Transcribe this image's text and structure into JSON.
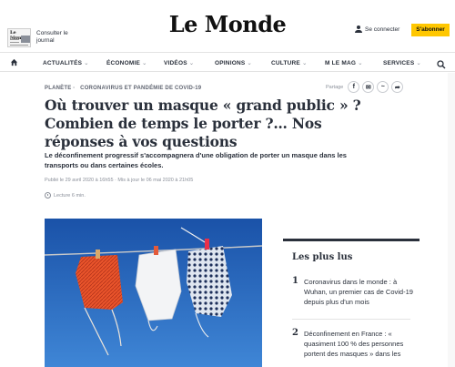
{
  "header": {
    "newspaper_thumb_title": "Le Monde",
    "consult_label": "Consulter le journal",
    "logo": "Le Monde",
    "login_label": "Se connecter",
    "subscribe_label": "S'abonner"
  },
  "nav": {
    "items": [
      "ACTUALITÉS",
      "ÉCONOMIE",
      "VIDÉOS",
      "OPINIONS",
      "CULTURE",
      "M LE MAG",
      "SERVICES"
    ],
    "chevron": "⌄"
  },
  "article": {
    "breadcrumb": [
      "PLANÈTE",
      "CORONAVIRUS ET PANDÉMIE DE COVID-19"
    ],
    "share_label": "Partage",
    "share_buttons": [
      "f",
      "✉",
      "~",
      "➦"
    ],
    "title": "Où trouver un masque « grand public » ? Combien de temps le porter ?… Nos réponses à vos questions",
    "description": "Le déconfinement progressif s'accompagnera d'une obligation de porter un masque dans les transports ou dans certaines écoles.",
    "meta": "Publié le 29 avril 2020 à 16h55 · Mis à jour le 06 mai 2020 à 21h05",
    "reading_time": "Lecture 6 min."
  },
  "sidebar": {
    "title": "Les plus lus",
    "items": [
      {
        "num": "1",
        "text": "Coronavirus dans le monde : à Wuhan, un premier cas de Covid-19 depuis plus d'un mois"
      },
      {
        "num": "2",
        "text": "Déconfinement en France : « quasiment 100 % des personnes portent des masques » dans les"
      }
    ]
  },
  "colors": {
    "text": "#2a303b",
    "subscribe": "#ffc700",
    "sky": "#1f5fb8"
  }
}
